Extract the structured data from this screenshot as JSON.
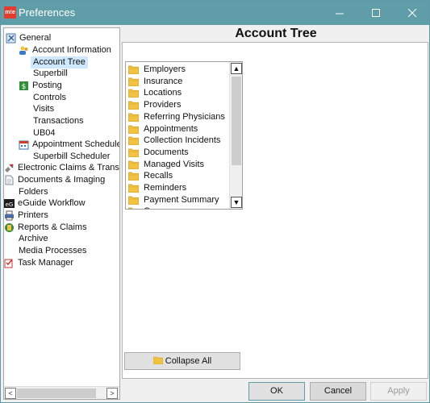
{
  "window": {
    "app_icon_text": "m!e",
    "title": "Preferences"
  },
  "tree": {
    "items": [
      {
        "label": "General",
        "icon": "settings-tools-icon"
      },
      {
        "label": "Account Information",
        "icon": "account-people-icon"
      },
      {
        "label": "Account Tree",
        "icon": "",
        "selected": true
      },
      {
        "label": "Superbill",
        "icon": ""
      },
      {
        "label": "Posting",
        "icon": "posting-dollar-icon"
      },
      {
        "label": "Controls",
        "icon": ""
      },
      {
        "label": "Visits",
        "icon": ""
      },
      {
        "label": "Transactions",
        "icon": ""
      },
      {
        "label": "UB04",
        "icon": ""
      },
      {
        "label": "Appointment Scheduler",
        "icon": "calendar-icon"
      },
      {
        "label": "Superbill Scheduler",
        "icon": ""
      },
      {
        "label": "Electronic Claims & Transmis",
        "icon": "satellite-icon"
      },
      {
        "label": "Documents & Imaging",
        "icon": "document-icon"
      },
      {
        "label": "Folders",
        "icon": ""
      },
      {
        "label": "eGuide Workflow",
        "icon": "eguide-icon"
      },
      {
        "label": "Printers",
        "icon": "printer-icon"
      },
      {
        "label": "Reports & Claims",
        "icon": "reports-icon"
      },
      {
        "label": "Archive",
        "icon": ""
      },
      {
        "label": "Media Processes",
        "icon": ""
      },
      {
        "label": "Task Manager",
        "icon": "task-manager-icon"
      }
    ]
  },
  "content": {
    "title": "Account Tree",
    "list_items": [
      "Employers",
      "Insurance",
      "Locations",
      "Providers",
      "Referring Physicians",
      "Appointments",
      "Collection Incidents",
      "Documents",
      "Managed Visits",
      "Recalls",
      "Reminders",
      "Payment Summary",
      "Cases"
    ],
    "collapse_label": "Collapse All"
  },
  "buttons": {
    "ok": "OK",
    "cancel": "Cancel",
    "apply": "Apply"
  },
  "colors": {
    "titlebar": "#5f9ea8",
    "selection": "#cde8ff",
    "folder": "#f2c243"
  }
}
